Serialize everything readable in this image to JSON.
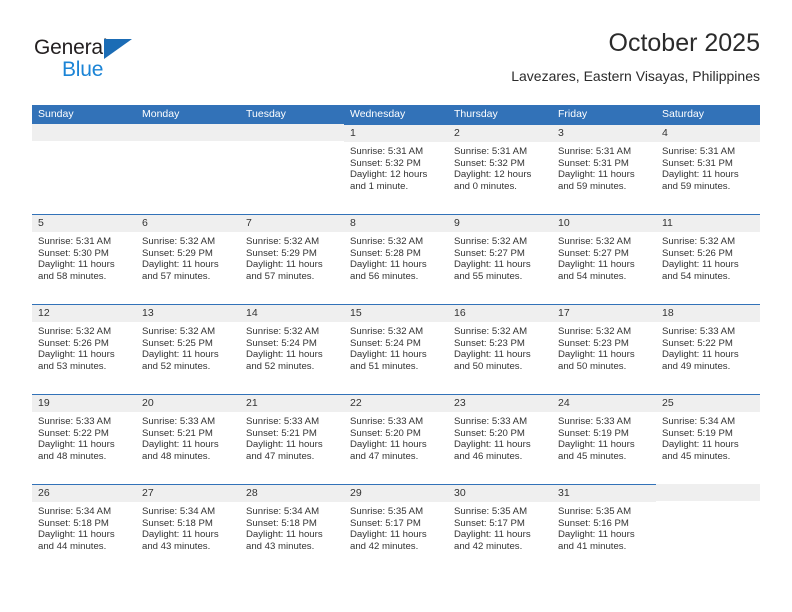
{
  "brand": {
    "name_part1": "General",
    "name_part2": "Blue",
    "triangle_color": "#1b6cb5",
    "blue_color": "#1b84d6"
  },
  "header": {
    "title": "October 2025",
    "subtitle": "Lavezares, Eastern Visayas, Philippines"
  },
  "theme": {
    "header_bar_color": "#3272b8",
    "date_strip_color": "#efefef",
    "text_color": "#333333"
  },
  "weekdays": [
    "Sunday",
    "Monday",
    "Tuesday",
    "Wednesday",
    "Thursday",
    "Friday",
    "Saturday"
  ],
  "weeks": [
    [
      {
        "date": "",
        "empty": true
      },
      {
        "date": "",
        "empty": true
      },
      {
        "date": "",
        "empty": true
      },
      {
        "date": "1",
        "sunrise": "Sunrise: 5:31 AM",
        "sunset": "Sunset: 5:32 PM",
        "daylight": "Daylight: 12 hours and 1 minute."
      },
      {
        "date": "2",
        "sunrise": "Sunrise: 5:31 AM",
        "sunset": "Sunset: 5:32 PM",
        "daylight": "Daylight: 12 hours and 0 minutes."
      },
      {
        "date": "3",
        "sunrise": "Sunrise: 5:31 AM",
        "sunset": "Sunset: 5:31 PM",
        "daylight": "Daylight: 11 hours and 59 minutes."
      },
      {
        "date": "4",
        "sunrise": "Sunrise: 5:31 AM",
        "sunset": "Sunset: 5:31 PM",
        "daylight": "Daylight: 11 hours and 59 minutes."
      }
    ],
    [
      {
        "date": "5",
        "sunrise": "Sunrise: 5:31 AM",
        "sunset": "Sunset: 5:30 PM",
        "daylight": "Daylight: 11 hours and 58 minutes."
      },
      {
        "date": "6",
        "sunrise": "Sunrise: 5:32 AM",
        "sunset": "Sunset: 5:29 PM",
        "daylight": "Daylight: 11 hours and 57 minutes."
      },
      {
        "date": "7",
        "sunrise": "Sunrise: 5:32 AM",
        "sunset": "Sunset: 5:29 PM",
        "daylight": "Daylight: 11 hours and 57 minutes."
      },
      {
        "date": "8",
        "sunrise": "Sunrise: 5:32 AM",
        "sunset": "Sunset: 5:28 PM",
        "daylight": "Daylight: 11 hours and 56 minutes."
      },
      {
        "date": "9",
        "sunrise": "Sunrise: 5:32 AM",
        "sunset": "Sunset: 5:27 PM",
        "daylight": "Daylight: 11 hours and 55 minutes."
      },
      {
        "date": "10",
        "sunrise": "Sunrise: 5:32 AM",
        "sunset": "Sunset: 5:27 PM",
        "daylight": "Daylight: 11 hours and 54 minutes."
      },
      {
        "date": "11",
        "sunrise": "Sunrise: 5:32 AM",
        "sunset": "Sunset: 5:26 PM",
        "daylight": "Daylight: 11 hours and 54 minutes."
      }
    ],
    [
      {
        "date": "12",
        "sunrise": "Sunrise: 5:32 AM",
        "sunset": "Sunset: 5:26 PM",
        "daylight": "Daylight: 11 hours and 53 minutes."
      },
      {
        "date": "13",
        "sunrise": "Sunrise: 5:32 AM",
        "sunset": "Sunset: 5:25 PM",
        "daylight": "Daylight: 11 hours and 52 minutes."
      },
      {
        "date": "14",
        "sunrise": "Sunrise: 5:32 AM",
        "sunset": "Sunset: 5:24 PM",
        "daylight": "Daylight: 11 hours and 52 minutes."
      },
      {
        "date": "15",
        "sunrise": "Sunrise: 5:32 AM",
        "sunset": "Sunset: 5:24 PM",
        "daylight": "Daylight: 11 hours and 51 minutes."
      },
      {
        "date": "16",
        "sunrise": "Sunrise: 5:32 AM",
        "sunset": "Sunset: 5:23 PM",
        "daylight": "Daylight: 11 hours and 50 minutes."
      },
      {
        "date": "17",
        "sunrise": "Sunrise: 5:32 AM",
        "sunset": "Sunset: 5:23 PM",
        "daylight": "Daylight: 11 hours and 50 minutes."
      },
      {
        "date": "18",
        "sunrise": "Sunrise: 5:33 AM",
        "sunset": "Sunset: 5:22 PM",
        "daylight": "Daylight: 11 hours and 49 minutes."
      }
    ],
    [
      {
        "date": "19",
        "sunrise": "Sunrise: 5:33 AM",
        "sunset": "Sunset: 5:22 PM",
        "daylight": "Daylight: 11 hours and 48 minutes."
      },
      {
        "date": "20",
        "sunrise": "Sunrise: 5:33 AM",
        "sunset": "Sunset: 5:21 PM",
        "daylight": "Daylight: 11 hours and 48 minutes."
      },
      {
        "date": "21",
        "sunrise": "Sunrise: 5:33 AM",
        "sunset": "Sunset: 5:21 PM",
        "daylight": "Daylight: 11 hours and 47 minutes."
      },
      {
        "date": "22",
        "sunrise": "Sunrise: 5:33 AM",
        "sunset": "Sunset: 5:20 PM",
        "daylight": "Daylight: 11 hours and 47 minutes."
      },
      {
        "date": "23",
        "sunrise": "Sunrise: 5:33 AM",
        "sunset": "Sunset: 5:20 PM",
        "daylight": "Daylight: 11 hours and 46 minutes."
      },
      {
        "date": "24",
        "sunrise": "Sunrise: 5:33 AM",
        "sunset": "Sunset: 5:19 PM",
        "daylight": "Daylight: 11 hours and 45 minutes."
      },
      {
        "date": "25",
        "sunrise": "Sunrise: 5:34 AM",
        "sunset": "Sunset: 5:19 PM",
        "daylight": "Daylight: 11 hours and 45 minutes."
      }
    ],
    [
      {
        "date": "26",
        "sunrise": "Sunrise: 5:34 AM",
        "sunset": "Sunset: 5:18 PM",
        "daylight": "Daylight: 11 hours and 44 minutes."
      },
      {
        "date": "27",
        "sunrise": "Sunrise: 5:34 AM",
        "sunset": "Sunset: 5:18 PM",
        "daylight": "Daylight: 11 hours and 43 minutes."
      },
      {
        "date": "28",
        "sunrise": "Sunrise: 5:34 AM",
        "sunset": "Sunset: 5:18 PM",
        "daylight": "Daylight: 11 hours and 43 minutes."
      },
      {
        "date": "29",
        "sunrise": "Sunrise: 5:35 AM",
        "sunset": "Sunset: 5:17 PM",
        "daylight": "Daylight: 11 hours and 42 minutes."
      },
      {
        "date": "30",
        "sunrise": "Sunrise: 5:35 AM",
        "sunset": "Sunset: 5:17 PM",
        "daylight": "Daylight: 11 hours and 42 minutes."
      },
      {
        "date": "31",
        "sunrise": "Sunrise: 5:35 AM",
        "sunset": "Sunset: 5:16 PM",
        "daylight": "Daylight: 11 hours and 41 minutes."
      },
      {
        "date": "",
        "empty": true
      }
    ]
  ]
}
